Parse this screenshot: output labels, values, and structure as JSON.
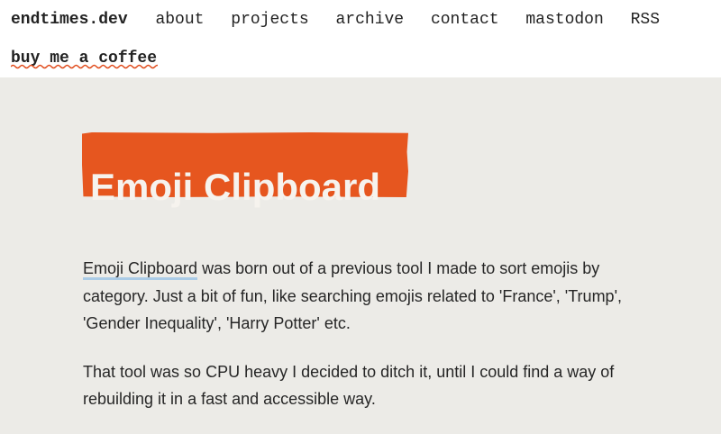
{
  "nav": {
    "brand": "endtimes.dev",
    "links": [
      "about",
      "projects",
      "archive",
      "contact",
      "mastodon",
      "RSS"
    ],
    "coffee": "buy me a coffee"
  },
  "colors": {
    "page_background": "#ecebe7",
    "nav_background": "#ffffff",
    "title_background": "#e6561f",
    "wavy_underline": "#e04a1a",
    "link_underline": "#aacbe6"
  },
  "article": {
    "title": "Emoji Clipboard",
    "paragraph1": {
      "link": "Emoji Clipboard",
      "text": " was born out of a previous tool I made to sort emojis by category. Just a bit of fun, like searching emojis related to 'France', 'Trump', 'Gender Inequality', 'Harry Potter' etc."
    },
    "paragraph2": "That tool was so CPU heavy I decided to ditch it, until I could find a way of rebuilding it in a fast and accessible way."
  }
}
